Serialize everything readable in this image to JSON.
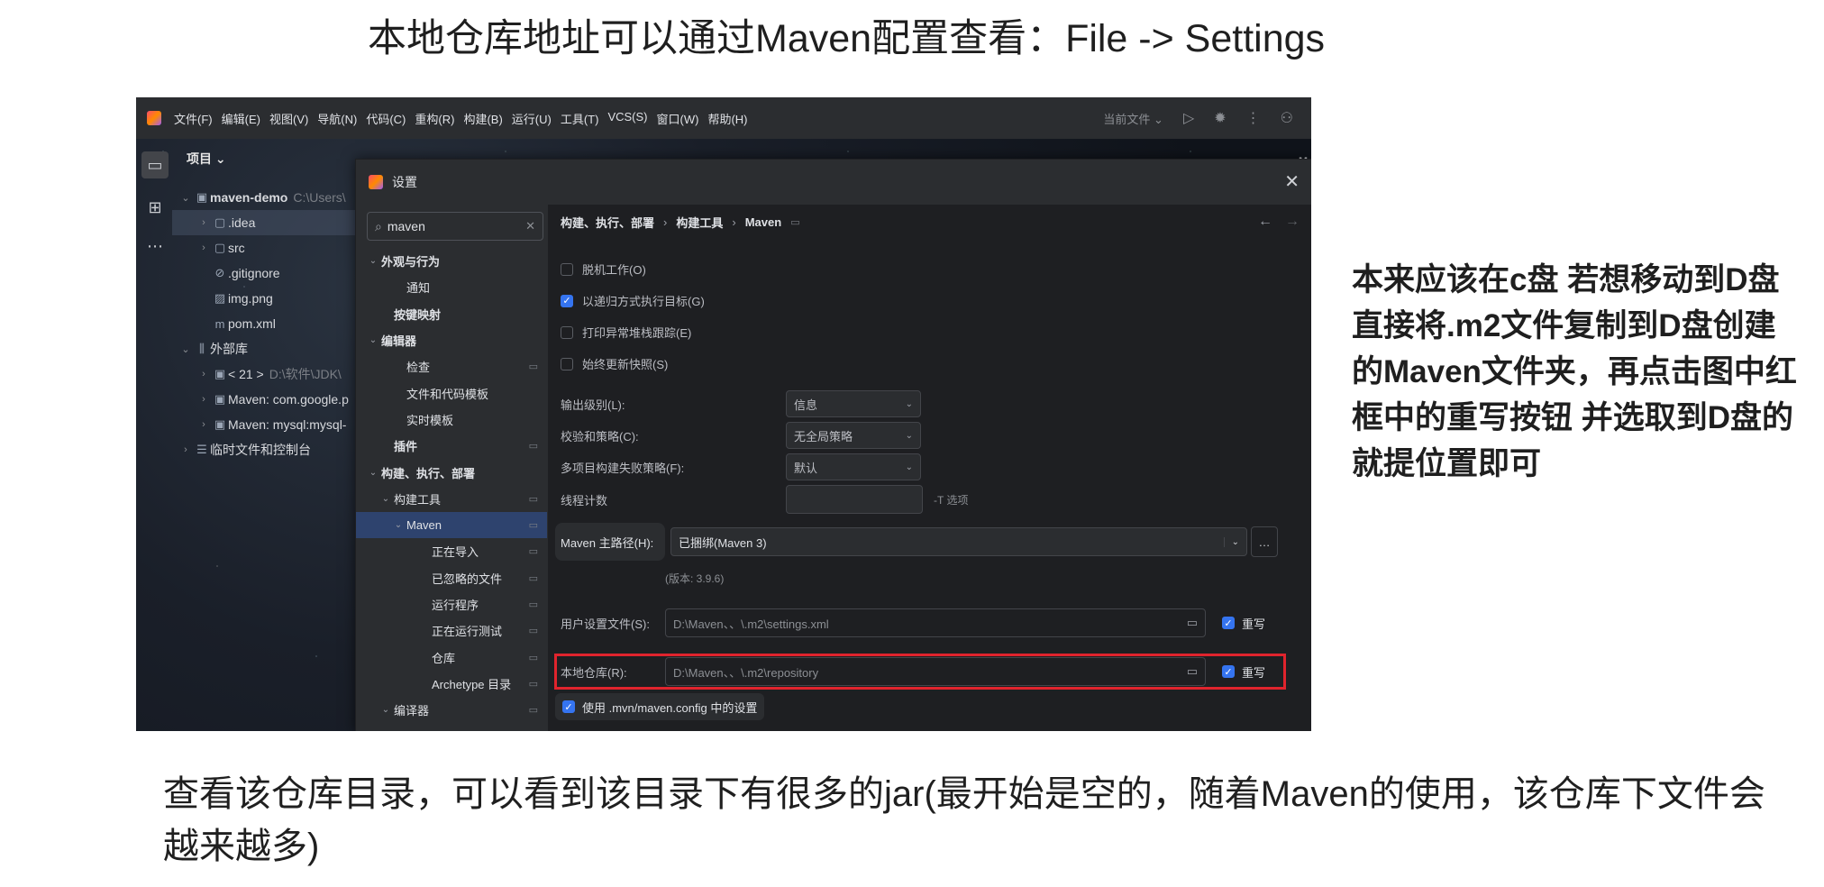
{
  "heading": "本地仓库地址可以通过Maven配置查看：File -> Settings",
  "side_note": "本来应该在c盘  若想移动到D盘  直接将.m2文件复制到D盘创建的Maven文件夹，再点击图中红框中的重写按钮 并选取到D盘的就提位置即可",
  "bottom_text": "查看该仓库目录，可以看到该目录下有很多的jar(最开始是空的，随着Maven的使用，该仓库下文件会越来越多)",
  "ide": {
    "menu": [
      "文件(F)",
      "编辑(E)",
      "视图(V)",
      "导航(N)",
      "代码(C)",
      "重构(R)",
      "构建(B)",
      "运行(U)",
      "工具(T)",
      "VCS(S)",
      "窗口(W)",
      "帮助(H)"
    ],
    "current_file": "当前文件",
    "project_label": "项目",
    "tree": [
      {
        "indent": 0,
        "arrow": "v",
        "icon": "folder-icon",
        "glyph": "▣",
        "label": "maven-demo",
        "muted": "C:\\Users\\",
        "bold": true
      },
      {
        "indent": 1,
        "arrow": ">",
        "icon": "folder-icon",
        "glyph": "▢",
        "label": ".idea",
        "muted": "",
        "selected": true
      },
      {
        "indent": 1,
        "arrow": ">",
        "icon": "folder-icon",
        "glyph": "▢",
        "label": "src",
        "muted": ""
      },
      {
        "indent": 1,
        "arrow": "",
        "icon": "ignore-file-icon",
        "glyph": "⊘",
        "label": ".gitignore",
        "muted": ""
      },
      {
        "indent": 1,
        "arrow": "",
        "icon": "image-file-icon",
        "glyph": "▨",
        "label": "img.png",
        "muted": ""
      },
      {
        "indent": 1,
        "arrow": "",
        "icon": "maven-file-icon",
        "glyph": "m",
        "label": "pom.xml",
        "muted": ""
      },
      {
        "indent": 0,
        "arrow": "v",
        "icon": "library-icon",
        "glyph": "⫼",
        "label": "外部库",
        "muted": ""
      },
      {
        "indent": 1,
        "arrow": ">",
        "icon": "jdk-icon",
        "glyph": "▣",
        "label": "< 21 >",
        "muted": "D:\\软件\\JDK\\"
      },
      {
        "indent": 1,
        "arrow": ">",
        "icon": "library-icon",
        "glyph": "▣",
        "label": "Maven: com.google.p",
        "muted": ""
      },
      {
        "indent": 1,
        "arrow": ">",
        "icon": "library-icon",
        "glyph": "▣",
        "label": "Maven: mysql:mysql-",
        "muted": ""
      },
      {
        "indent": 0,
        "arrow": ">",
        "icon": "scratch-icon",
        "glyph": "☰",
        "label": "临时文件和控制台",
        "muted": ""
      }
    ]
  },
  "settings": {
    "title": "设置",
    "search_value": "maven",
    "nav": [
      {
        "indent": 0,
        "caret": "v",
        "label": "外观与行为",
        "bold": true,
        "pin": false
      },
      {
        "indent": 2,
        "caret": "",
        "label": "通知",
        "bold": false,
        "pin": false
      },
      {
        "indent": 1,
        "caret": "",
        "label": "按键映射",
        "bold": true,
        "pin": false
      },
      {
        "indent": 0,
        "caret": "v",
        "label": "编辑器",
        "bold": true,
        "pin": false
      },
      {
        "indent": 2,
        "caret": "",
        "label": "检查",
        "bold": false,
        "pin": true
      },
      {
        "indent": 2,
        "caret": "",
        "label": "文件和代码模板",
        "bold": false,
        "pin": false
      },
      {
        "indent": 2,
        "caret": "",
        "label": "实时模板",
        "bold": false,
        "pin": false
      },
      {
        "indent": 1,
        "caret": "",
        "label": "插件",
        "bold": true,
        "pin": true
      },
      {
        "indent": 0,
        "caret": "v",
        "label": "构建、执行、部署",
        "bold": true,
        "pin": false
      },
      {
        "indent": 1,
        "caret": "v",
        "label": "构建工具",
        "bold": false,
        "pin": true
      },
      {
        "indent": 2,
        "caret": "v",
        "label": "Maven",
        "bold": false,
        "pin": true,
        "selected": true
      },
      {
        "indent": 4,
        "caret": "",
        "label": "正在导入",
        "bold": false,
        "pin": true
      },
      {
        "indent": 4,
        "caret": "",
        "label": "已忽略的文件",
        "bold": false,
        "pin": true
      },
      {
        "indent": 4,
        "caret": "",
        "label": "运行程序",
        "bold": false,
        "pin": true
      },
      {
        "indent": 4,
        "caret": "",
        "label": "正在运行测试",
        "bold": false,
        "pin": true
      },
      {
        "indent": 4,
        "caret": "",
        "label": "仓库",
        "bold": false,
        "pin": true
      },
      {
        "indent": 4,
        "caret": "",
        "label": "Archetype 目录",
        "bold": false,
        "pin": true
      },
      {
        "indent": 1,
        "caret": "v",
        "label": "编译器",
        "bold": false,
        "pin": true
      }
    ],
    "breadcrumb": [
      "构建、执行、部署",
      "构建工具",
      "Maven"
    ],
    "checkboxes": [
      {
        "label": "脱机工作(O)",
        "checked": false
      },
      {
        "label": "以递归方式执行目标(G)",
        "checked": true
      },
      {
        "label": "打印异常堆栈跟踪(E)",
        "checked": false
      },
      {
        "label": "始终更新快照(S)",
        "checked": false
      }
    ],
    "output_level_label": "输出级别(L):",
    "output_level_value": "信息",
    "checksum_label": "校验和策略(C):",
    "checksum_value": "无全局策略",
    "multiproject_label": "多项目构建失败策略(F):",
    "multiproject_value": "默认",
    "threads_label": "线程计数",
    "threads_hint": "-T 选项",
    "maven_home_label": "Maven 主路径(H):",
    "maven_home_value": "已捆绑(Maven 3)",
    "version": "(版本: 3.9.6)",
    "user_settings_label": "用户设置文件(S):",
    "user_settings_value": "D:\\Maven、、\\.m2\\settings.xml",
    "local_repo_label": "本地仓库(R):",
    "local_repo_value": "D:\\Maven、、\\.m2\\repository",
    "override_label": "重写",
    "mvn_config_label": "使用 .mvn/maven.config 中的设置"
  }
}
